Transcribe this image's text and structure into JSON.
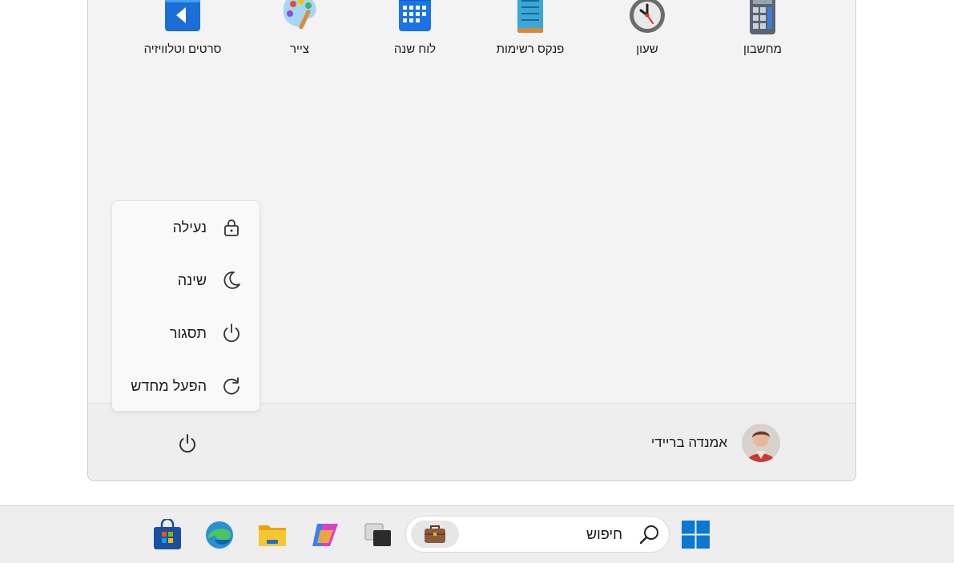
{
  "start_menu": {
    "pinned_apps": [
      {
        "label": "סרטים וטלוויזיה",
        "icon": "movies-tv-icon"
      },
      {
        "label": "צייר",
        "icon": "paint-icon"
      },
      {
        "label": "לוח שנה",
        "icon": "calendar-icon"
      },
      {
        "label": "פנקס רשימות",
        "icon": "notepad-icon"
      },
      {
        "label": "שעון",
        "icon": "clock-icon"
      },
      {
        "label": "מחשבון",
        "icon": "calculator-icon"
      }
    ],
    "user": {
      "name": "אמנדה ברײדי"
    },
    "power_menu": [
      {
        "label": "נעילה",
        "icon": "lock-icon"
      },
      {
        "label": "שינה",
        "icon": "moon-icon"
      },
      {
        "label": "תסגור",
        "icon": "power-icon"
      },
      {
        "label": "הפעל מחדש",
        "icon": "restart-icon"
      }
    ]
  },
  "taskbar": {
    "search_text": "חיפוש",
    "icons": [
      "microsoft-store-icon",
      "edge-icon",
      "file-explorer-icon",
      "copilot-icon",
      "task-view-icon",
      "briefcase-icon",
      "search-icon",
      "windows-start-icon"
    ]
  },
  "colors": {
    "accent": "#0a64c4",
    "panel": "#f3f3f3",
    "taskbar": "#eeeeee"
  }
}
